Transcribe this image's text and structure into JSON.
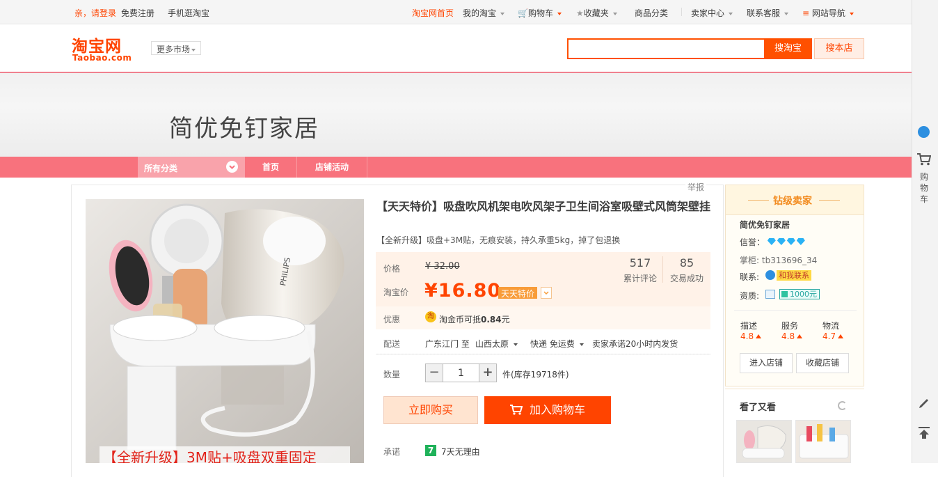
{
  "topbar": {
    "login": "亲，请登录",
    "register": "免费注册",
    "mobile": "手机逛淘宝",
    "home": "淘宝网首页",
    "my_taobao": "我的淘宝",
    "cart": "购物车",
    "favorites": "收藏夹",
    "categories": "商品分类",
    "seller_center": "卖家中心",
    "service": "联系客服",
    "site_nav": "网站导航"
  },
  "header": {
    "logo_cn": "淘宝网",
    "logo_en": "Taobao.com",
    "more_markets": "更多市场",
    "search_value": "",
    "search_button": "搜淘宝",
    "search_shop_button": "搜本店"
  },
  "shop": {
    "name": "简优免钉家居"
  },
  "nav": {
    "all_categories": "所有分类",
    "items": [
      "首页",
      "店铺活动"
    ]
  },
  "product": {
    "report": "举报",
    "title": "【天天特价】吸盘吹风机架电吹风架子卫生间浴室吸壁式风筒架壁挂",
    "subtitle": "【全新升级】吸盘+3M贴，无痕安装，持久承重5kg，掉了包退换",
    "image_caption": "【全新升级】3M贴+吸盘双重固定",
    "image_brand": "PHILIPS",
    "price_label": "价格",
    "original_price": "¥ 32.00",
    "taobao_price_label": "淘宝价",
    "price": "¥16.80",
    "price_tag": "天天特价",
    "reviews_count": "517",
    "reviews_label": "累计评论",
    "deals_count": "85",
    "deals_label": "交易成功",
    "promo_label": "优惠",
    "coin_icon_text": "淘",
    "promo_text_prefix": "淘金币可抵",
    "promo_amount": "0.84",
    "promo_text_suffix": "元",
    "shipping_label": "配送",
    "ship_from": "广东江门 至",
    "ship_to": "山西太原",
    "ship_method": "快递 免运费",
    "ship_promise": "卖家承诺20小时内发货",
    "qty_label": "数量",
    "qty_minus": "−",
    "qty_value": "1",
    "qty_plus": "+",
    "stock": "件(库存19718件)",
    "buy_now": "立即购买",
    "add_to_cart": "加入购物车",
    "promise_label": "承诺",
    "promise_icon_text": "7",
    "promise_text": "7天无理由"
  },
  "seller": {
    "level": "钻级卖家",
    "name": "简优免钉家居",
    "credit_label": "信誉：",
    "credit_diamonds": 4,
    "owner_label": "掌柜:",
    "owner": "tb313696_34",
    "contact_label": "联系:",
    "contact_button": "和我联系",
    "qualification_label": "资质:",
    "deposit": "1000元",
    "ratings": [
      {
        "label": "描述",
        "value": "4.8"
      },
      {
        "label": "服务",
        "value": "4.8"
      },
      {
        "label": "物流",
        "value": "4.7"
      }
    ],
    "enter_shop": "进入店铺",
    "favorite_shop": "收藏店铺",
    "also_viewed": "看了又看"
  },
  "sidebar": {
    "cart_text": "购物车"
  },
  "colors": {
    "brand": "#ff4400",
    "nav": "#f8727d",
    "price_bg": "#fff2e8"
  }
}
